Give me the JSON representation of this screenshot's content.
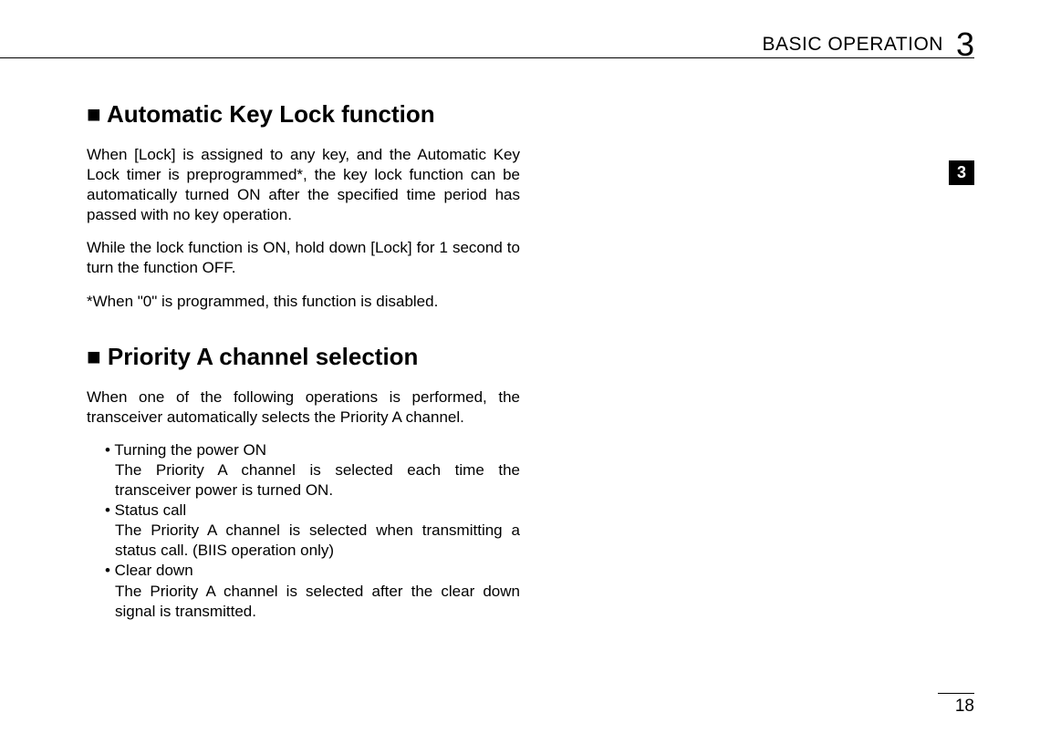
{
  "header": {
    "title": "BASIC OPERATION",
    "chapter": "3"
  },
  "sideTab": "3",
  "section1": {
    "heading": "■ Automatic Key Lock function",
    "para1": "When [Lock] is assigned to any key, and the Automatic Key Lock timer is preprogrammed*, the key lock function can be automatically turned ON after the specified time period has passed with no key operation.",
    "para2": "While the lock function is ON, hold down [Lock] for 1 second to turn the function OFF.",
    "para3": "*When \"0\" is programmed, this function is disabled."
  },
  "section2": {
    "heading": "■ Priority A channel selection",
    "intro": "When one of the following operations is performed, the transceiver automatically selects the Priority A channel.",
    "bullets": [
      {
        "head": "• Turning the power ON",
        "desc": "The Priority A channel is selected each time the transceiver power is turned ON."
      },
      {
        "head": "• Status call",
        "desc": "The Priority A channel is selected when transmitting a status call. (BIIS operation only)"
      },
      {
        "head": "• Clear down",
        "desc": "The Priority A channel is selected after the clear down signal is transmitted."
      }
    ]
  },
  "pageNumber": "18"
}
